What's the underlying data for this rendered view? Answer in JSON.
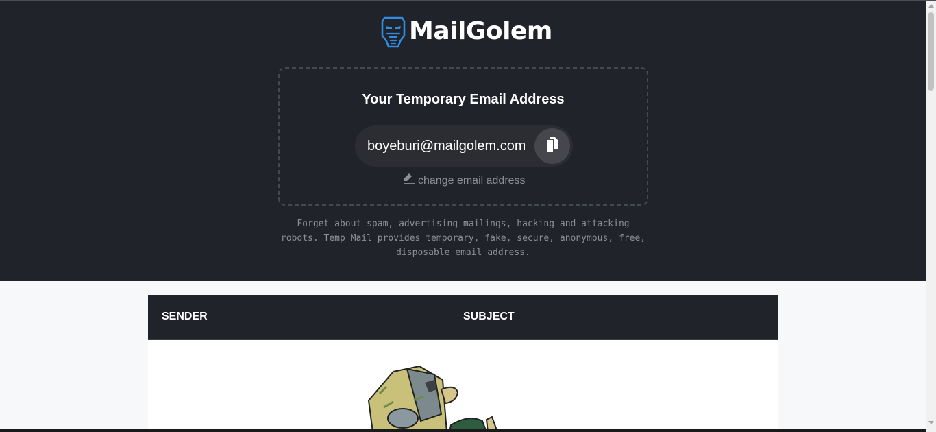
{
  "brand": {
    "name": "MailGolem",
    "accent_color": "#2f8ce0",
    "logo_icon": "golem-head-icon"
  },
  "email_box": {
    "title": "Your Temporary Email Address",
    "address": "boyeburi@mailgolem.com",
    "copy_icon": "copy-icon",
    "change_label": "change email address",
    "change_icon": "pen-icon"
  },
  "tagline": "Forget about spam, advertising mailings, hacking and attacking robots. Temp Mail provides temporary, fake, secure, anonymous, free, disposable email address.",
  "inbox": {
    "columns": [
      "SENDER",
      "SUBJECT"
    ],
    "empty_illustration": "golem-holding-envelope-illustration"
  }
}
